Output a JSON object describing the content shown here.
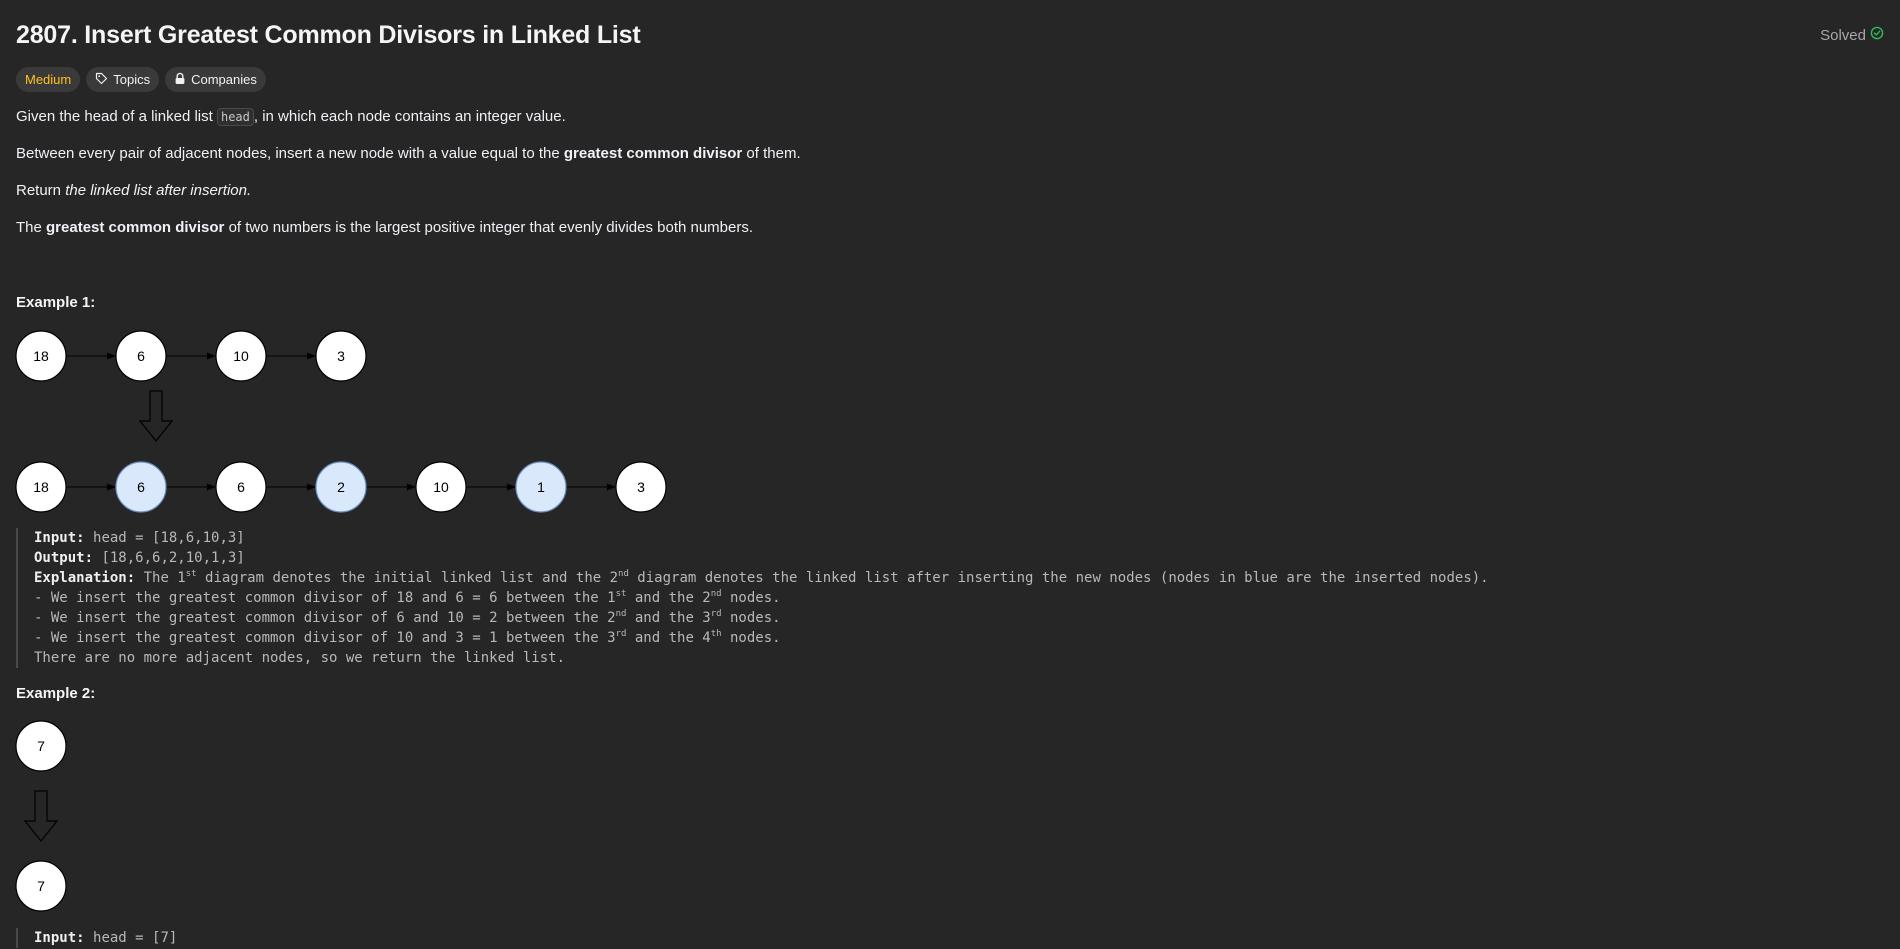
{
  "problem": {
    "title": "2807. Insert Greatest Common Divisors in Linked List",
    "status": "Solved",
    "tags": [
      {
        "label": "Medium"
      },
      {
        "label": "Topics"
      },
      {
        "label": "Companies"
      }
    ]
  },
  "description": {
    "p1": {
      "before": "Given the head of a linked list ",
      "code": "head",
      "after": ", in which each node contains an integer value."
    },
    "p2": {
      "before": "Between every pair of adjacent nodes, insert a new node with a value equal to the ",
      "bold": "greatest common divisor",
      "after": " of them."
    },
    "p3": {
      "before": "Return ",
      "italic": "the linked list after insertion."
    },
    "p4": {
      "before": "The ",
      "bold": "greatest common divisor",
      "after": " of two numbers is the largest positive integer that evenly divides both numbers."
    }
  },
  "example1": {
    "title": "Example 1:",
    "list_before": [
      "18",
      "6",
      "10",
      "3"
    ],
    "list_after": [
      "18",
      "6",
      "6",
      "2",
      "10",
      "1",
      "3"
    ],
    "inserted_flags": [
      false,
      true,
      false,
      true,
      false,
      true,
      false
    ],
    "input_label": "Input:",
    "input_value": "head = [18,6,10,3]",
    "output_label": "Output:",
    "output_value": "[18,6,6,2,10,1,3]",
    "explanation_label": "Explanation:",
    "explanation": {
      "e1": "The 1",
      "e2": "st",
      "e3": " diagram denotes the initial linked list and the 2",
      "e4": "nd",
      "e5": " diagram denotes the linked list after inserting the new nodes (nodes in blue are the inserted nodes)."
    },
    "steps": [
      {
        "a": "- We insert the greatest common divisor of 18 and 6 = 6 between the 1",
        "s1": "st",
        "b": " and the 2",
        "s2": "nd",
        "c": " nodes."
      },
      {
        "a": "- We insert the greatest common divisor of 6 and 10 = 2 between the 2",
        "s1": "nd",
        "b": " and the 3",
        "s2": "rd",
        "c": " nodes."
      },
      {
        "a": "- We insert the greatest common divisor of 10 and 3 = 1 between the 3",
        "s1": "rd",
        "b": " and the 4",
        "s2": "th",
        "c": " nodes."
      }
    ],
    "final": "There are no more adjacent nodes, so we return the linked list."
  },
  "example2": {
    "title": "Example 2:",
    "list_before": [
      "7"
    ],
    "list_after": [
      "7"
    ],
    "input_label": "Input:",
    "input_value": "head = [7]"
  },
  "colors": {
    "background": "#262626",
    "medium": "#ffc01e",
    "solved_check": "#2cbb5d",
    "node_fill": "#ffffff",
    "inserted_fill": "#dae8fc",
    "inserted_stroke": "#6c8ebf"
  }
}
